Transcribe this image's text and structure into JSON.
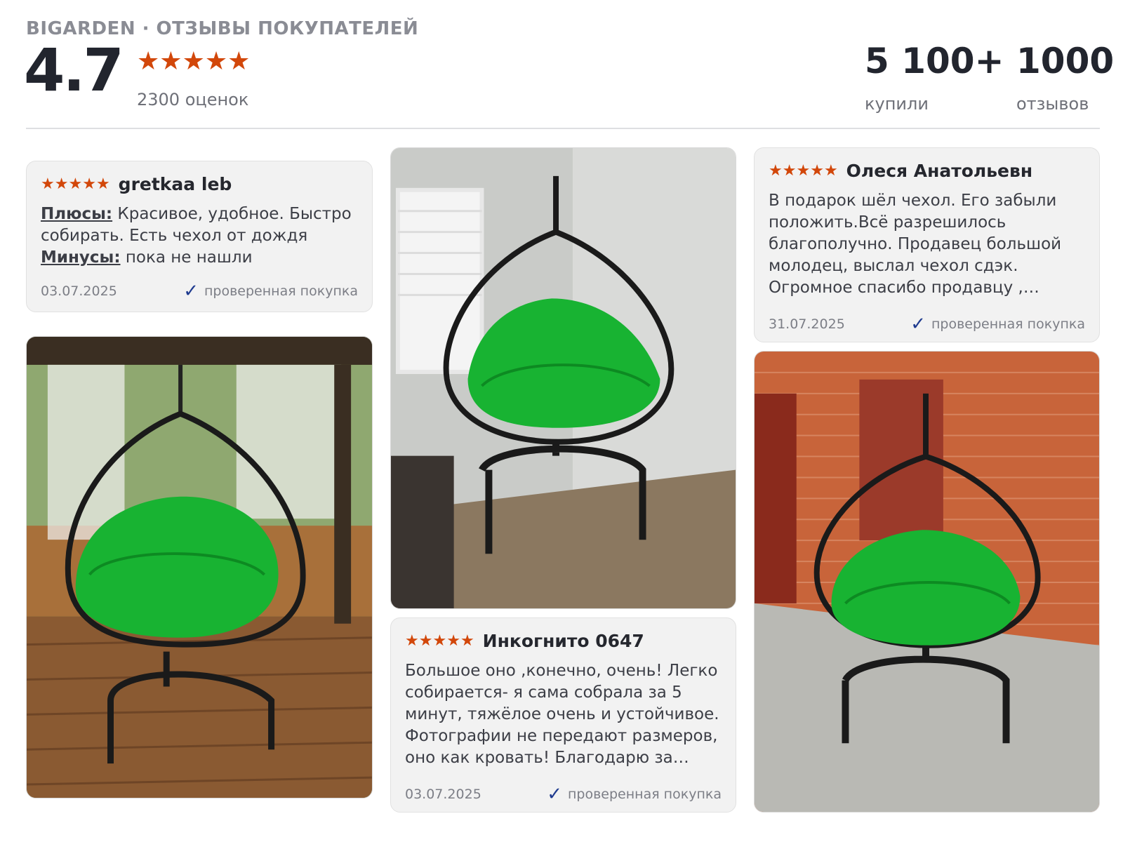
{
  "header": {
    "brand": "BIGARDEN · ОТЗЫВЫ ПОКУПАТЕЛЕЙ",
    "rating": "4.7",
    "ratings_count": "2300 оценок",
    "stars": 5,
    "bought_value": "5 100+",
    "bought_label": "купили",
    "reviews_value": "1000",
    "reviews_label": "отзывов"
  },
  "reviews": [
    {
      "author": "gretkaa leb",
      "stars": 5,
      "pros_label": "Плюсы:",
      "pros_text": " Красивое, удобное. Быстро собирать. Есть чехол от дождя",
      "cons_label": "Минусы:",
      "cons_text": " пока не нашли",
      "date": "03.07.2025",
      "verified": "проверенная покупка"
    },
    {
      "author": "Олеся Анатольевн",
      "stars": 5,
      "text": "В подарок шёл чехол. Его забыли положить.Всё разрешилось благополучно. Продавец большой молодец, выслал чехол сдэк. Огромное спасибо продавцу , успехов и хороши...",
      "date": "31.07.2025",
      "verified": "проверенная покупка"
    },
    {
      "author": "Инкогнито 0647",
      "stars": 5,
      "text": "Большое оно ,конечно, очень! Легко собирается- я сама собрала за 5 минут, тяжёлое очень и устойчивое. Фотографии не передают размеров, оно как кровать! Благодарю за товар,...",
      "date": "03.07.2025",
      "verified": "проверенная покупка"
    }
  ],
  "colors": {
    "star": "#d2470a",
    "check": "#1f3b8f",
    "cushion": "#18b332"
  },
  "icons": [
    "star-icon",
    "check-icon"
  ]
}
